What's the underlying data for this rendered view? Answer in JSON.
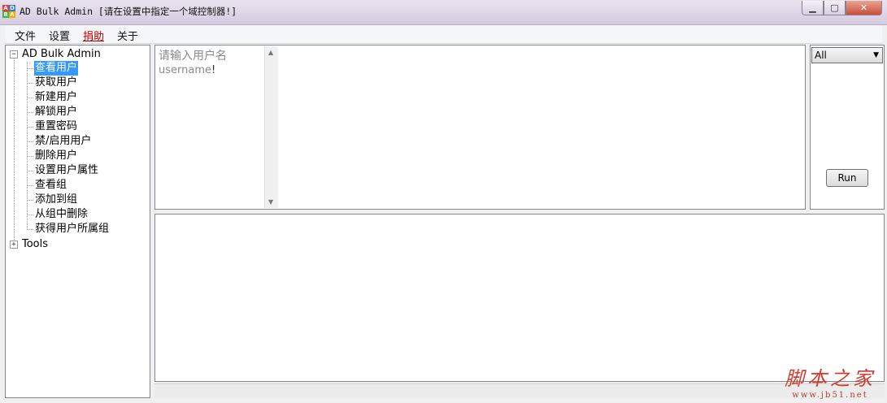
{
  "window": {
    "title": "AD Bulk Admin [请在设置中指定一个域控制器!]",
    "icon_letters": [
      "A",
      "D",
      "B",
      "A"
    ],
    "buttons": {
      "minimize": "▁",
      "maximize": "▢",
      "close": "✕"
    }
  },
  "menu": {
    "file": "文件",
    "settings": "设置",
    "donate": "捐助",
    "about": "关于"
  },
  "tree": {
    "root_label": "AD Bulk Admin",
    "root_expander": "−",
    "items": [
      {
        "label": "查看用户"
      },
      {
        "label": "获取用户"
      },
      {
        "label": "新建用户"
      },
      {
        "label": "解锁用户"
      },
      {
        "label": "重置密码"
      },
      {
        "label": "禁/启用用户"
      },
      {
        "label": "删除用户"
      },
      {
        "label": "设置用户属性"
      },
      {
        "label": "查看组"
      },
      {
        "label": "添加到组"
      },
      {
        "label": "从组中删除"
      },
      {
        "label": "获得用户所属组"
      }
    ],
    "selected_index": 0,
    "tools_label": "Tools",
    "tools_expander": "+"
  },
  "input": {
    "placeholder": "请输入用户名",
    "example": "username",
    "example_suffix": "!"
  },
  "side": {
    "filter_value": "All",
    "run_label": "Run"
  },
  "watermark": {
    "main": "脚本之家",
    "sub": "www.jb51.net"
  },
  "colors": {
    "selection": "#3399ff",
    "donate": "#c00000",
    "watermark": "#d33a2c"
  }
}
